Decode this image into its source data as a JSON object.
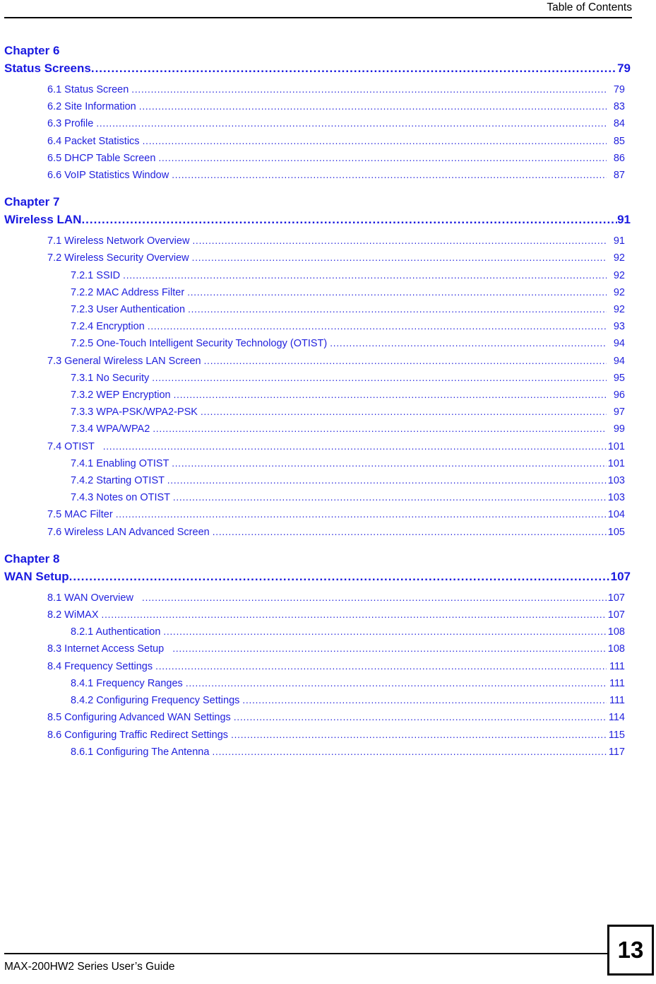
{
  "header": {
    "title": "Table of Contents"
  },
  "footer": {
    "guide_title": "MAX-200HW2 Series User’s Guide",
    "page_number": "13"
  },
  "colors": {
    "link_blue": "#2222dd",
    "heading_blue": "#1a1ae0",
    "text_black": "#000000"
  },
  "leader": "................................................................................................................................................................................................",
  "chapters": [
    {
      "label": "Chapter  6",
      "title": "Status Screens",
      "page": "79",
      "entries": [
        {
          "level": 1,
          "title": "6.1 Status Screen ",
          "page": "79"
        },
        {
          "level": 1,
          "title": "6.2 Site Information ",
          "page": "83"
        },
        {
          "level": 1,
          "title": "6.3 Profile ",
          "page": "84"
        },
        {
          "level": 1,
          "title": "6.4 Packet Statistics ",
          "page": "85"
        },
        {
          "level": 1,
          "title": "6.5 DHCP Table Screen ",
          "page": "86"
        },
        {
          "level": 1,
          "title": "6.6 VoIP Statistics Window ",
          "page": "87"
        }
      ]
    },
    {
      "label": "Chapter  7",
      "title": "Wireless LAN",
      "page": "91",
      "entries": [
        {
          "level": 1,
          "title": "7.1 Wireless Network Overview ",
          "page": "91"
        },
        {
          "level": 1,
          "title": "7.2 Wireless Security Overview ",
          "page": "92"
        },
        {
          "level": 2,
          "title": "7.2.1 SSID ",
          "page": "92"
        },
        {
          "level": 2,
          "title": "7.2.2 MAC Address Filter ",
          "page": "92"
        },
        {
          "level": 2,
          "title": "7.2.3 User Authentication ",
          "page": "92"
        },
        {
          "level": 2,
          "title": "7.2.4 Encryption ",
          "page": "93"
        },
        {
          "level": 2,
          "title": "7.2.5 One-Touch Intelligent Security Technology (OTIST) ",
          "page": "94"
        },
        {
          "level": 1,
          "title": "7.3 General Wireless LAN Screen ",
          "page": "94"
        },
        {
          "level": 2,
          "title": "7.3.1 No Security ",
          "page": "95"
        },
        {
          "level": 2,
          "title": "7.3.2 WEP Encryption ",
          "page": "96"
        },
        {
          "level": 2,
          "title": "7.3.3 WPA-PSK/WPA2-PSK ",
          "page": "97"
        },
        {
          "level": 2,
          "title": "7.3.4 WPA/WPA2 ",
          "page": "99"
        },
        {
          "level": 1,
          "title": "7.4 OTIST   ",
          "page": "101"
        },
        {
          "level": 2,
          "title": "7.4.1 Enabling OTIST ",
          "page": "101"
        },
        {
          "level": 2,
          "title": "7.4.2 Starting OTIST ",
          "page": "103"
        },
        {
          "level": 2,
          "title": "7.4.3 Notes on OTIST ",
          "page": "103"
        },
        {
          "level": 1,
          "title": "7.5 MAC Filter ",
          "page": "104"
        },
        {
          "level": 1,
          "title": "7.6 Wireless LAN Advanced Screen ",
          "page": "105"
        }
      ]
    },
    {
      "label": "Chapter  8",
      "title": "WAN Setup",
      "page": "107",
      "entries": [
        {
          "level": 1,
          "title": "8.1 WAN Overview   ",
          "page": "107"
        },
        {
          "level": 1,
          "title": "8.2 WiMAX ",
          "page": "107"
        },
        {
          "level": 2,
          "title": "8.2.1 Authentication ",
          "page": "108"
        },
        {
          "level": 1,
          "title": "8.3 Internet Access Setup   ",
          "page": "108"
        },
        {
          "level": 1,
          "title": "8.4 Frequency Settings ",
          "page": "111"
        },
        {
          "level": 2,
          "title": "8.4.1 Frequency Ranges ",
          "page": "111"
        },
        {
          "level": 2,
          "title": "8.4.2 Configuring Frequency Settings ",
          "page": "111"
        },
        {
          "level": 1,
          "title": "8.5 Configuring Advanced WAN Settings ",
          "page": "114"
        },
        {
          "level": 1,
          "title": "8.6 Configuring Traffic Redirect Settings ",
          "page": "115"
        },
        {
          "level": 2,
          "title": "8.6.1 Configuring The Antenna ",
          "page": "117"
        }
      ]
    }
  ]
}
